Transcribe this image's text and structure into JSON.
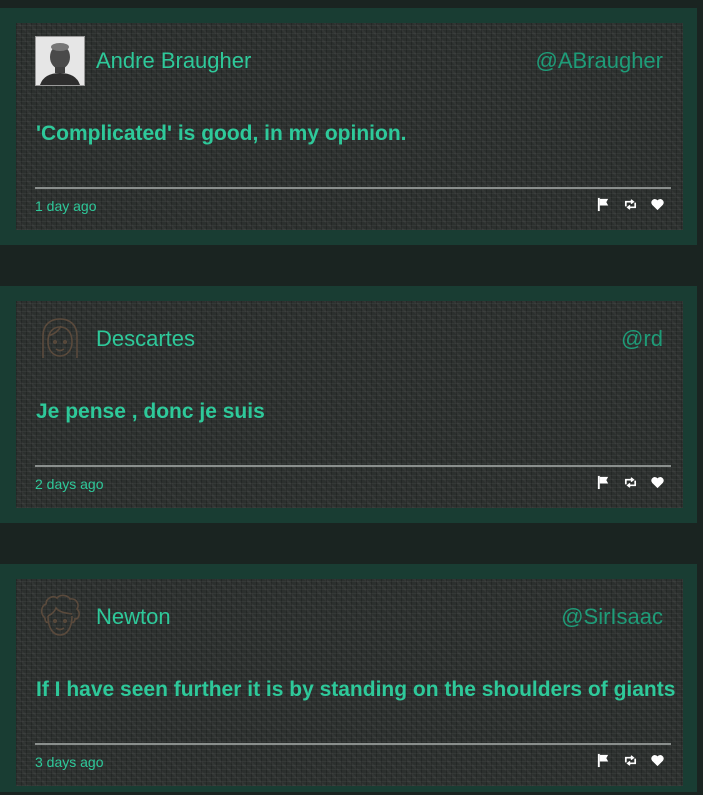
{
  "colors": {
    "accent": "#2ec99a",
    "handle": "#1e9c78",
    "frame": "#193d33",
    "card": "#2c302e",
    "background": "#1a2421"
  },
  "posts": [
    {
      "author": "Andre Braugher",
      "handle": "@ABraugher",
      "avatar": "photo-avatar",
      "message": "'Complicated' is good, in my opinion.",
      "timestamp": "1 day ago",
      "actions": [
        "flag-icon",
        "retweet-icon",
        "heart-icon"
      ]
    },
    {
      "author": "Descartes",
      "handle": "@rd",
      "avatar": "female-face-icon",
      "message": "Je pense , donc je suis",
      "timestamp": "2 days ago",
      "actions": [
        "flag-icon",
        "retweet-icon",
        "heart-icon"
      ]
    },
    {
      "author": "Newton",
      "handle": "@SirIsaac",
      "avatar": "curly-hair-face-icon",
      "message": "If I have seen further it is by standing on the shoulders of giants",
      "timestamp": "3 days ago",
      "actions": [
        "flag-icon",
        "retweet-icon",
        "heart-icon"
      ]
    }
  ]
}
